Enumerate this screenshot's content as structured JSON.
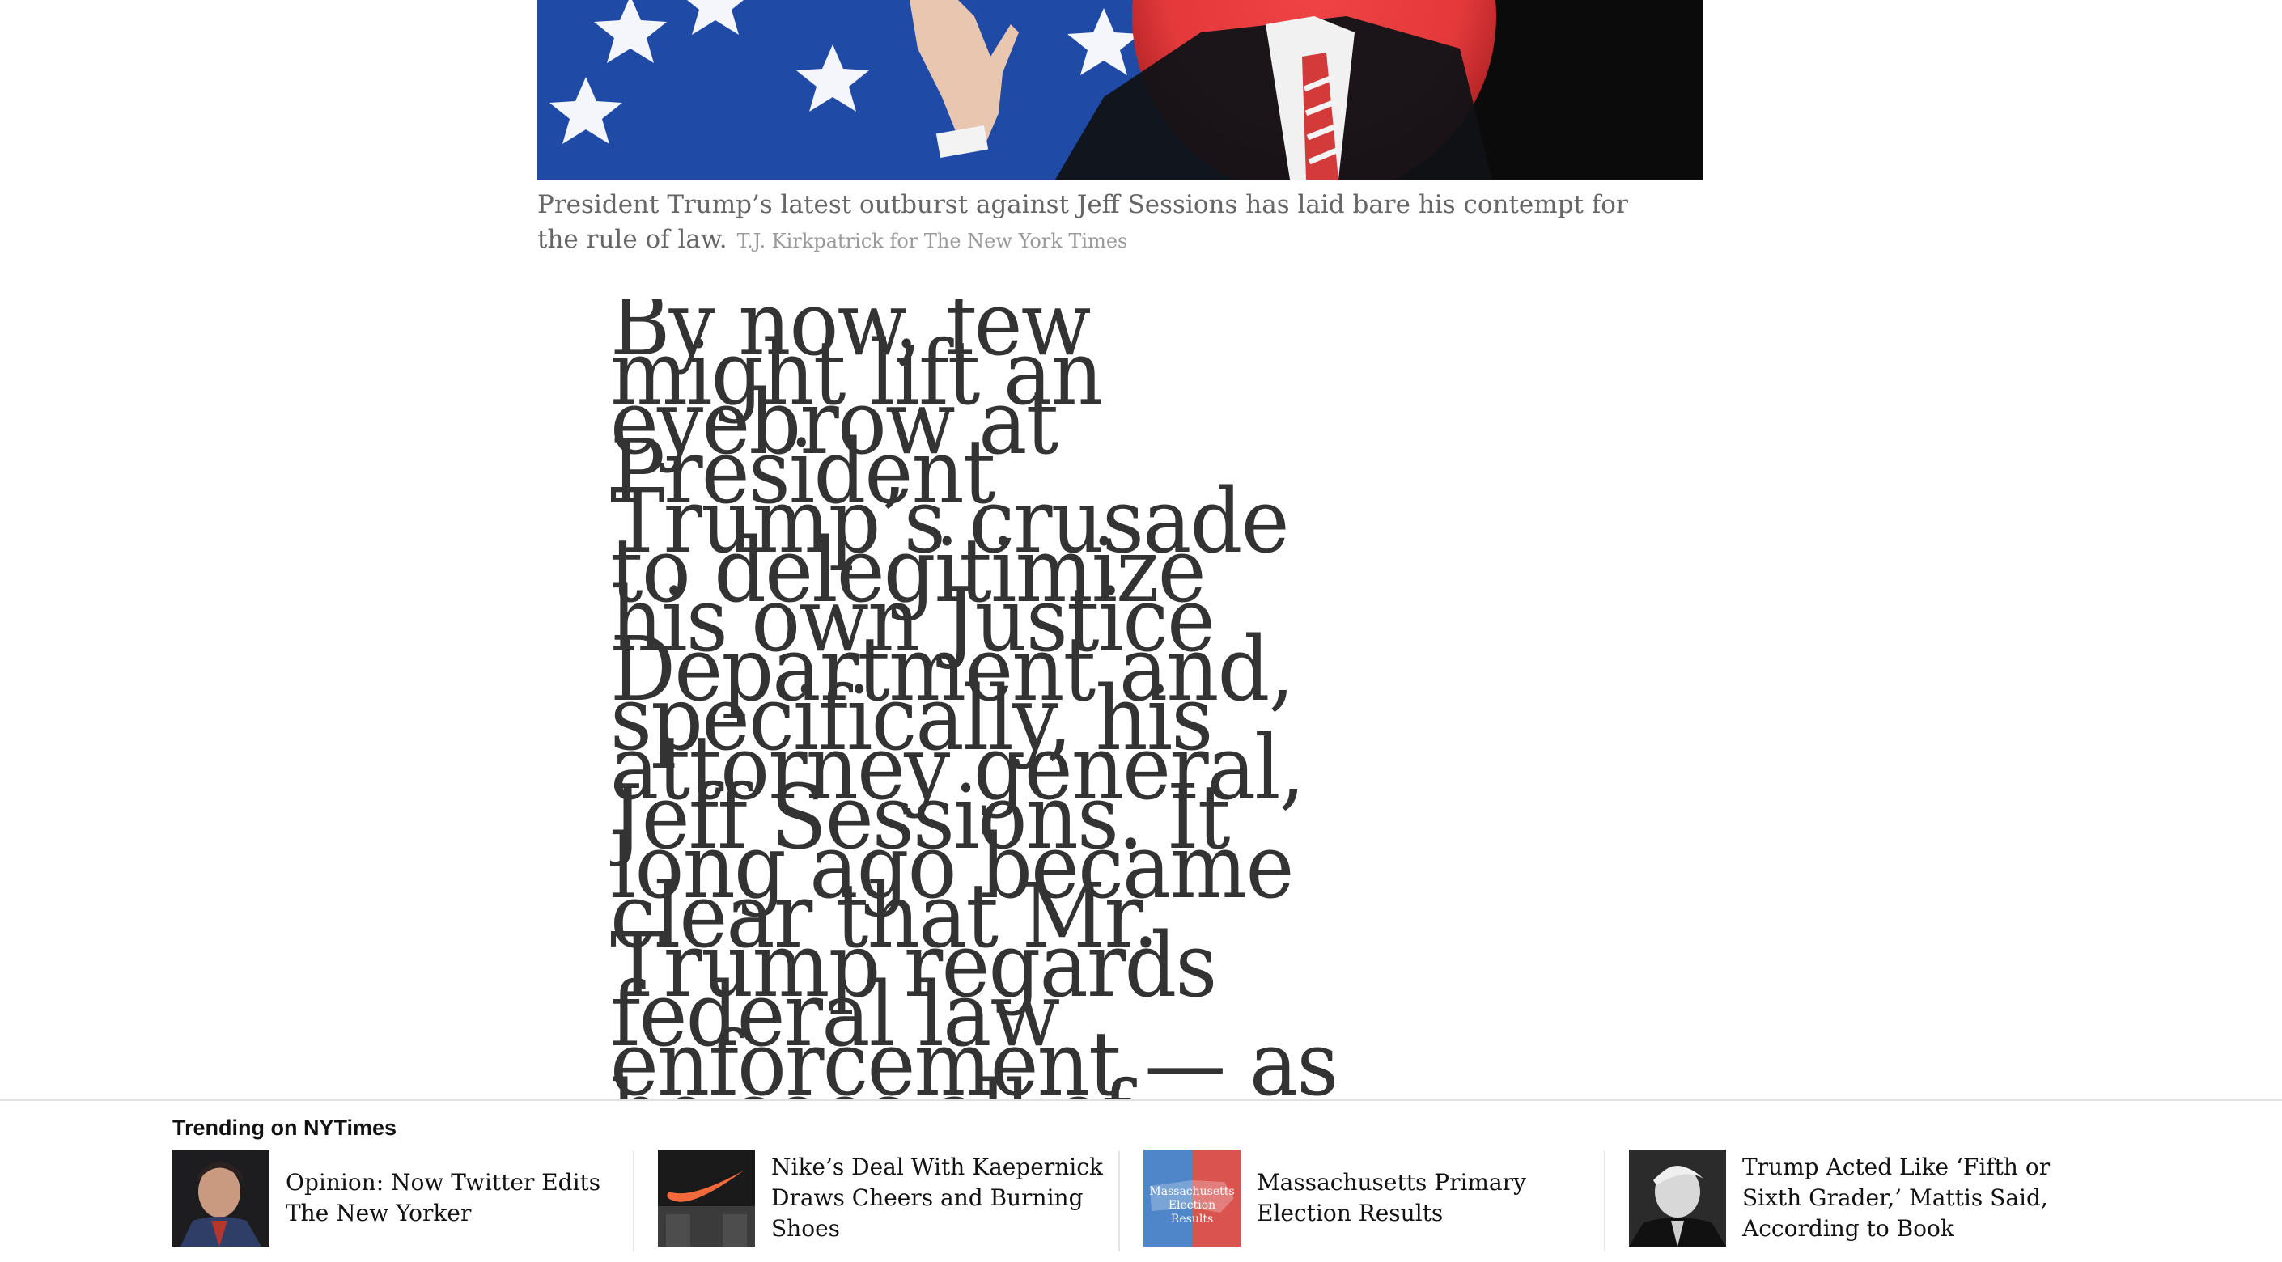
{
  "caption": {
    "text": "President Trump’s latest outburst against Jeff Sessions has laid bare his contempt for the rule of law.",
    "credit": "T.J. Kirkpatrick for The New York Times"
  },
  "article": {
    "text": "By now, few might lift an eyebrow at President Trump’s crusade to delegitimize his own Justice Department and, specifically, his attorney general, Jeff Sessions. It long ago became clear that Mr. Trump regards federal law enforcement — as he sees all of"
  },
  "trending": {
    "title": "Trending on NYTimes",
    "items": [
      {
        "headline": "Opinion: Now Twitter Edits The New Yorker"
      },
      {
        "headline": "Nike’s Deal With Kaepernick Draws Cheers and Burning Shoes"
      },
      {
        "headline": "Massachusetts Primary Election Results",
        "thumb_label": "Massachusetts Election Results"
      },
      {
        "headline": "Trump Acted Like ‘Fifth or Sixth Grader,’ Mattis Said, According to Book"
      }
    ]
  },
  "colors": {
    "flag_blue": "#1e49a8",
    "spotlight_red": "#e83a3c",
    "caption_text": "#666666",
    "credit_text": "#999999",
    "article_text": "#333333",
    "nike_orange": "#f26a3b"
  }
}
